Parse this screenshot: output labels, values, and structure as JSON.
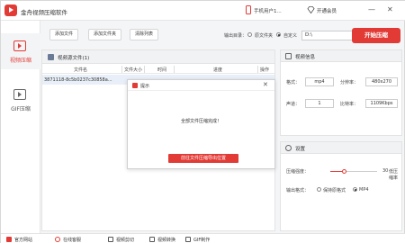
{
  "app": {
    "title": "金舟视频压缩软件"
  },
  "header": {
    "user": "手机用户1...",
    "vip": "开通会员",
    "minimize": "—",
    "close": "✕"
  },
  "sidebar": {
    "items": [
      {
        "label": "视频压缩"
      },
      {
        "label": "GIF压缩"
      }
    ]
  },
  "toolbar": {
    "add_file": "添加文件",
    "add_folder": "添加文件夹",
    "clear_list": "清除列表",
    "output_label": "输出目录：",
    "option_original": "原文件夹",
    "option_custom": "自定义",
    "path_value": "D:\\",
    "start_button": "开始压缩"
  },
  "files": {
    "title": "视频源文件(1)",
    "columns": [
      "文件名",
      "文件大小",
      "时间",
      "进度",
      "操作"
    ],
    "rows": [
      {
        "name": "3871118-8c5b0237c30858a..."
      }
    ]
  },
  "video_info": {
    "title": "视频信息",
    "format_label": "格式：",
    "format_value": "mp4",
    "resolution_label": "分辨率：",
    "resolution_value": "480x270",
    "channel_label": "声道：",
    "channel_value": "1",
    "bitrate_label": "比特率：",
    "bitrate_value": "1109Kbps"
  },
  "settings": {
    "title": "设置",
    "strength_label": "压缩强度：",
    "strength_value": "30",
    "strength_hint": "低压缩率",
    "strength_level": 0.3,
    "output_format_label": "输出格式：",
    "option_keep": "保持原格式",
    "option_mp4": "MP4"
  },
  "dialog": {
    "title": "提示",
    "message": "全部文件压缩完成！",
    "button": "前往文件压缩导出位置",
    "close": "✕"
  },
  "bottom": {
    "items": [
      {
        "label": "官方网站",
        "color": "#e23a35"
      },
      {
        "label": "在线客服",
        "color": "#e23a35"
      },
      {
        "label": "视频剪切",
        "color": "#555555"
      },
      {
        "label": "视频转换",
        "color": "#555555"
      },
      {
        "label": "GIF制作",
        "color": "#555555"
      }
    ]
  }
}
